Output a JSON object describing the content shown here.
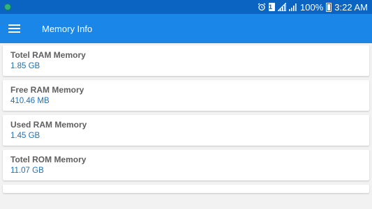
{
  "status_bar": {
    "battery_percent": "100%",
    "time": "3:22 AM",
    "sim_label": "1",
    "icons": [
      "app-notification-icon",
      "alarm-icon",
      "sim-icon",
      "signal-icon",
      "signal-icon",
      "battery-icon"
    ]
  },
  "app_bar": {
    "title": "Memory Info",
    "menu_icon": "hamburger-menu-icon"
  },
  "cards": [
    {
      "label": "Totel RAM Memory",
      "value": "1.85 GB"
    },
    {
      "label": "Free RAM Memory",
      "value": "410.46 MB"
    },
    {
      "label": "Used RAM Memory",
      "value": "1.45 GB"
    },
    {
      "label": "Totel ROM Memory",
      "value": "11.07 GB"
    }
  ],
  "colors": {
    "status_bar": "#0b63c2",
    "app_bar": "#1a87e8",
    "label_text": "#5f5f5f",
    "value_text": "#1f6fb5",
    "background": "#f2f2f2"
  }
}
